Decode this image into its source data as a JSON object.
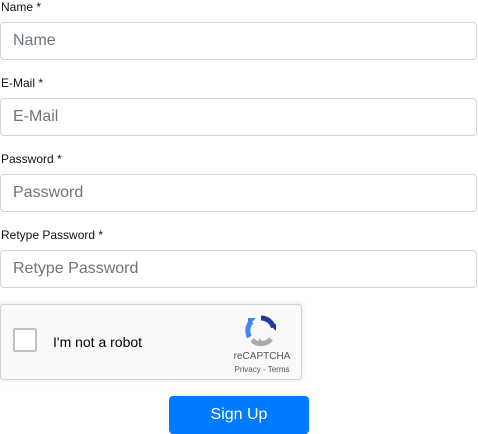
{
  "form": {
    "fields": [
      {
        "label": "Name *",
        "value": "",
        "placeholder": "Name"
      },
      {
        "label": "E-Mail *",
        "value": "",
        "placeholder": "E-Mail"
      },
      {
        "label": "Password *",
        "value": "",
        "placeholder": "Password"
      },
      {
        "label": "Retype Password *",
        "value": "",
        "placeholder": "Retype Password"
      }
    ],
    "recaptcha": {
      "checkbox_label": "I'm not a robot",
      "checked": false,
      "brand": "reCAPTCHA",
      "privacy_label": "Privacy",
      "separator": " - ",
      "terms_label": "Terms",
      "colors": {
        "logo_dark_blue": "#1c3aa9",
        "logo_blue": "#4285f4",
        "logo_gray": "#ababab"
      }
    },
    "submit_label": "Sign Up",
    "accent_color": "#007bff"
  }
}
